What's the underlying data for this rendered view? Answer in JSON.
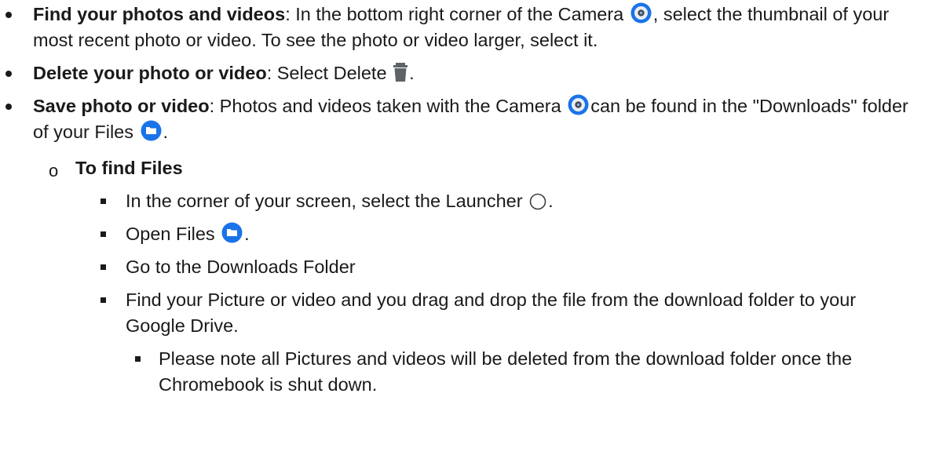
{
  "items": [
    {
      "title": "Find your photos and videos",
      "t1": ": In the bottom right corner of the Camera ",
      "icon1": "camera-icon",
      "t2": ", select the thumbnail of your most recent photo or video. To see the photo or video larger, select it."
    },
    {
      "title": "Delete your photo or video",
      "t1": ": Select Delete ",
      "icon1": "trash-icon",
      "t2": "."
    },
    {
      "title": "Save photo or video",
      "t1": ": Photos and videos taken with the Camera ",
      "icon1": "camera-icon",
      "t2": "can be found in the \"Downloads\" folder of your Files ",
      "icon2": "files-icon",
      "t3": "."
    }
  ],
  "sub_heading": "To find Files",
  "steps": [
    {
      "t1": "In the corner of your screen, select the Launcher ",
      "icon": "launcher-icon",
      "t2": "."
    },
    {
      "t1": "Open Files ",
      "icon": "files-icon",
      "t2": "."
    },
    {
      "t1": "Go to the Downloads Folder"
    },
    {
      "t1": "Find your Picture or video and you drag and drop the file from the download folder to your Google Drive."
    }
  ],
  "note": "Please note all Pictures and videos will be deleted from the download folder once the Chromebook is shut down.",
  "colors": {
    "camera_ring": "#1a73e8",
    "camera_center": "#4a4a4a",
    "trash": "#5f6368",
    "files": "#1a73e8"
  }
}
